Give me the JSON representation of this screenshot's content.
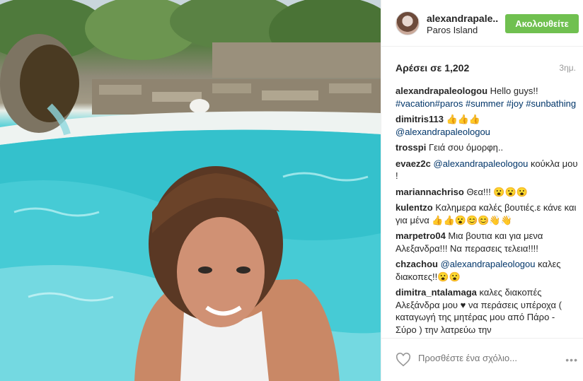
{
  "header": {
    "username": "alexandrapale..",
    "location": "Paros Island",
    "follow_label": "Ακολουθείτε"
  },
  "stats": {
    "likes": "Αρέσει σε 1,202",
    "time": "3ημ."
  },
  "comments": [
    {
      "user": "alexandrapaleologou",
      "text": " Hello guys!!",
      "tags": "#vacation#paros #summer #joy #sunbathing"
    },
    {
      "user": "dimitris113",
      "text": " 👍👍👍",
      "tags": "@alexandrapaleologou"
    },
    {
      "user": "trosspi",
      "text": " Γειά σου όμορφη.."
    },
    {
      "user": "evaez2c",
      "tags": " @alexandrapaleologou",
      "text": " κούκλα μου !"
    },
    {
      "user": "mariannachriso",
      "text": " Θεα!!! 😮😮😮"
    },
    {
      "user": "kulentzo",
      "text": " Καλημερα καλές βουτιές.ε κάνε και για μένα 👍👍😮😊😊👋👋"
    },
    {
      "user": "marpetro04",
      "text": " Μια βουτια και για μενα Αλεξανδρα!!! Να περασεις τελεια!!!!"
    },
    {
      "user": "chzachou",
      "tags": " @alexandrapaleologou",
      "text": " καλες διακοπες!!😮😮"
    },
    {
      "user": "dimitra_ntalamaga",
      "text": " καλες διακοπές Αλεξάνδρα μου ♥ να περάσεις υπέροχα ( καταγωγή της μητέρας μου από Πάρο - Σύρο ) την λατρεύω την"
    }
  ],
  "footer": {
    "comment_placeholder": "Προσθέστε ένα σχόλιο...",
    "more_label": "•••"
  },
  "colors": {
    "follow": "#70c050",
    "hashtag": "#003569",
    "water": "#37c4cf"
  },
  "icons": {
    "heart": "heart-outline-icon",
    "more": "more-options-icon"
  }
}
